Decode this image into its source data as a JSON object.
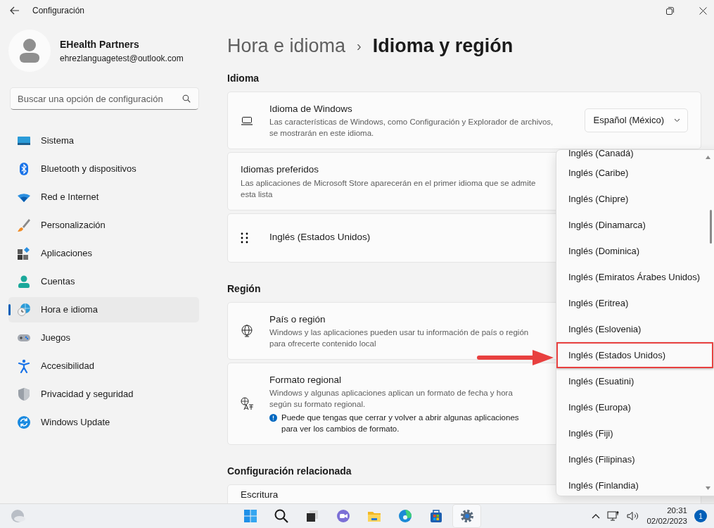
{
  "window": {
    "title": "Configuración"
  },
  "profile": {
    "name": "EHealth Partners",
    "email": "ehrezlanguagetest@outlook.com"
  },
  "search": {
    "placeholder": "Buscar una opción de configuración"
  },
  "sidebar": {
    "items": [
      {
        "label": "Sistema",
        "kind": "system",
        "selected": false
      },
      {
        "label": "Bluetooth y dispositivos",
        "kind": "bluetooth",
        "selected": false
      },
      {
        "label": "Red e Internet",
        "kind": "network",
        "selected": false
      },
      {
        "label": "Personalización",
        "kind": "brush",
        "selected": false
      },
      {
        "label": "Aplicaciones",
        "kind": "apps",
        "selected": false
      },
      {
        "label": "Cuentas",
        "kind": "accounts",
        "selected": false
      },
      {
        "label": "Hora e idioma",
        "kind": "time",
        "selected": true
      },
      {
        "label": "Juegos",
        "kind": "gaming",
        "selected": false
      },
      {
        "label": "Accesibilidad",
        "kind": "accessibility",
        "selected": false
      },
      {
        "label": "Privacidad y seguridad",
        "kind": "privacy",
        "selected": false
      },
      {
        "label": "Windows Update",
        "kind": "update",
        "selected": false
      }
    ]
  },
  "breadcrumb": {
    "parent": "Hora e idioma",
    "separator": "›",
    "current": "Idioma y región"
  },
  "sections": [
    {
      "heading": "Idioma",
      "cards": [
        {
          "kind": "laptop",
          "title": "Idioma de Windows",
          "description_lines": [
            "Las características de Windows, como Configuración y Explorador de archivos,",
            "se mostrarán en este idioma."
          ],
          "dropdown": "Español (México)"
        },
        {
          "kind": "plain",
          "title": "Idiomas preferidos",
          "description_lines": [
            "Las aplicaciones de Microsoft Store aparecerán en el primer idioma que se admite",
            "esta lista"
          ]
        },
        {
          "kind": "language",
          "title": "Inglés (Estados Unidos)"
        }
      ]
    },
    {
      "heading": "Región",
      "cards": [
        {
          "kind": "globe",
          "title": "País o región",
          "description_lines": [
            "Windows y las aplicaciones pueden usar tu información de país o región",
            "para ofrecerte contenido local"
          ]
        },
        {
          "kind": "translate",
          "title": "Formato regional",
          "description_lines": [
            "Windows y algunas aplicaciones aplican un formato de fecha y hora",
            "según su formato regional."
          ],
          "note_lines": [
            "Puede que tengas que cerrar y volver a abrir algunas aplicaciones",
            "para ver los cambios de formato."
          ]
        }
      ]
    },
    {
      "heading": "Configuración relacionada",
      "cards": [
        {
          "kind": "plain",
          "title": "Escritura"
        }
      ]
    }
  ],
  "country_list": {
    "items": [
      {
        "label": "Inglés (Canadá)",
        "highlighted": false
      },
      {
        "label": "Inglés (Caribe)",
        "highlighted": false
      },
      {
        "label": "Inglés (Chipre)",
        "highlighted": false
      },
      {
        "label": "Inglés (Dinamarca)",
        "highlighted": false
      },
      {
        "label": "Inglés (Dominica)",
        "highlighted": false
      },
      {
        "label": "Inglés (Emiratos Árabes Unidos)",
        "highlighted": false
      },
      {
        "label": "Inglés (Eritrea)",
        "highlighted": false
      },
      {
        "label": "Inglés (Eslovenia)",
        "highlighted": false
      },
      {
        "label": "Inglés (Estados Unidos)",
        "highlighted": true
      },
      {
        "label": "Inglés (Esuatini)",
        "highlighted": false
      },
      {
        "label": "Inglés (Europa)",
        "highlighted": false
      },
      {
        "label": "Inglés (Fiji)",
        "highlighted": false
      },
      {
        "label": "Inglés (Filipinas)",
        "highlighted": false
      },
      {
        "label": "Inglés (Finlandia)",
        "highlighted": false
      }
    ]
  },
  "taskbar": {
    "apps": [
      {
        "kind": "start",
        "selected": false
      },
      {
        "kind": "search",
        "selected": false
      },
      {
        "kind": "taskview",
        "selected": false
      },
      {
        "kind": "chat",
        "selected": false
      },
      {
        "kind": "folder",
        "selected": false
      },
      {
        "kind": "browser",
        "selected": false
      },
      {
        "kind": "store",
        "selected": false
      },
      {
        "kind": "settings",
        "selected": true
      }
    ],
    "time": "20:31",
    "date": "02/02/2023",
    "notifications": "1"
  }
}
